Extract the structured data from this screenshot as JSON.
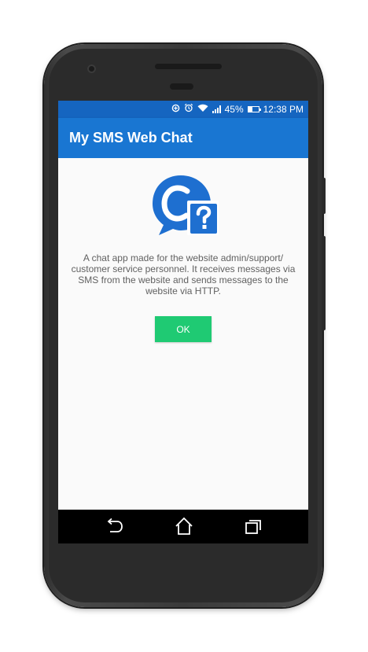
{
  "status_bar": {
    "battery_percent": "45%",
    "time": "12:38 PM",
    "icons": [
      "data-saver-icon",
      "alarm-icon",
      "wifi-icon",
      "signal-icon",
      "battery-icon"
    ]
  },
  "app_bar": {
    "title": "My SMS Web Chat"
  },
  "dialog": {
    "logo_icon": "chat-help-logo-icon",
    "description": "A chat app made for the website admin/support/ customer service personnel.  It receives messages via SMS from the website and sends messages to the website via HTTP.",
    "ok_label": "OK"
  },
  "nav_bar": {
    "icons": [
      "back-icon",
      "home-icon",
      "recents-icon"
    ]
  },
  "colors": {
    "status_bar": "#1565c0",
    "app_bar": "#1976d2",
    "ok_button": "#1fca73",
    "logo_blue": "#1e6fd0"
  }
}
